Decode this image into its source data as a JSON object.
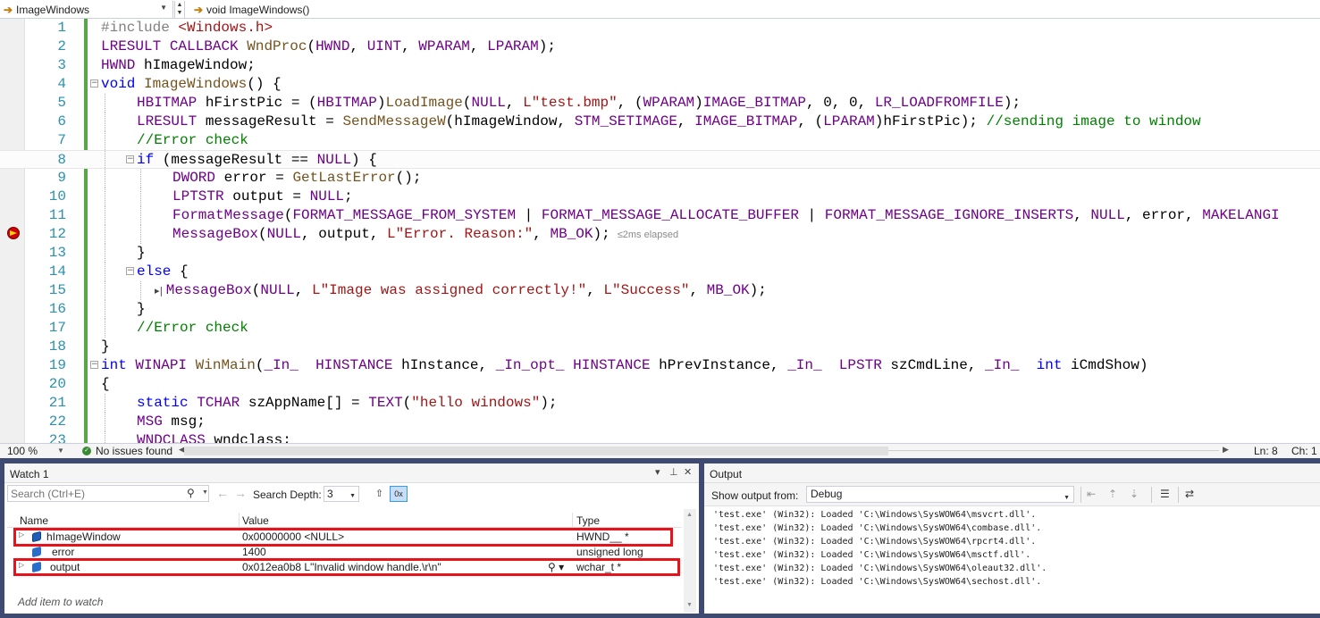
{
  "navbar": {
    "scope": "ImageWindows",
    "member": "void ImageWindows()"
  },
  "editor": {
    "lines": [
      {
        "n": "1",
        "parts": [
          [
            "pp",
            "#include "
          ],
          [
            "str",
            "<Windows.h>"
          ]
        ]
      },
      {
        "n": "2",
        "parts": [
          [
            "mac",
            "LRESULT"
          ],
          [
            "",
            " "
          ],
          [
            "mac",
            "CALLBACK"
          ],
          [
            "",
            " "
          ],
          [
            "fn",
            "WndProc"
          ],
          [
            "",
            "("
          ],
          [
            "mac",
            "HWND"
          ],
          [
            "",
            ", "
          ],
          [
            "mac",
            "UINT"
          ],
          [
            "",
            ", "
          ],
          [
            "mac",
            "WPARAM"
          ],
          [
            "",
            ", "
          ],
          [
            "mac",
            "LPARAM"
          ],
          [
            "",
            ");"
          ]
        ]
      },
      {
        "n": "3",
        "parts": [
          [
            "mac",
            "HWND"
          ],
          [
            "",
            " hImageWindow;"
          ]
        ]
      },
      {
        "n": "4",
        "fold": "−",
        "parts": [
          [
            "k",
            "void"
          ],
          [
            "",
            " "
          ],
          [
            "fn",
            "ImageWindows"
          ],
          [
            "",
            "() {"
          ]
        ]
      },
      {
        "n": "5",
        "indent": 1,
        "parts": [
          [
            "mac",
            "HBITMAP"
          ],
          [
            "",
            " hFirstPic = ("
          ],
          [
            "mac",
            "HBITMAP"
          ],
          [
            "",
            ")"
          ],
          [
            "fn",
            "LoadImage"
          ],
          [
            "",
            "("
          ],
          [
            "mac",
            "NULL"
          ],
          [
            "",
            ", "
          ],
          [
            "str",
            "L\"test.bmp\""
          ],
          [
            "",
            ", ("
          ],
          [
            "mac",
            "WPARAM"
          ],
          [
            "",
            ")"
          ],
          [
            "mac",
            "IMAGE_BITMAP"
          ],
          [
            "",
            ", "
          ],
          [
            "num",
            "0"
          ],
          [
            "",
            ", "
          ],
          [
            "num",
            "0"
          ],
          [
            "",
            ", "
          ],
          [
            "mac",
            "LR_LOADFROMFILE"
          ],
          [
            "",
            ");"
          ]
        ]
      },
      {
        "n": "6",
        "indent": 1,
        "parts": [
          [
            "mac",
            "LRESULT"
          ],
          [
            "",
            " messageResult = "
          ],
          [
            "fn",
            "SendMessageW"
          ],
          [
            "",
            "(hImageWindow, "
          ],
          [
            "mac",
            "STM_SETIMAGE"
          ],
          [
            "",
            ", "
          ],
          [
            "mac",
            "IMAGE_BITMAP"
          ],
          [
            "",
            ", ("
          ],
          [
            "mac",
            "LPARAM"
          ],
          [
            "",
            ")hFirstPic); "
          ],
          [
            "cm",
            "//sending image to window"
          ]
        ]
      },
      {
        "n": "7",
        "indent": 1,
        "parts": [
          [
            "cm",
            "//Error check"
          ]
        ]
      },
      {
        "n": "8",
        "indent": 1,
        "fold": "−",
        "current": true,
        "parts": [
          [
            "k",
            "if"
          ],
          [
            "",
            " (messageResult == "
          ],
          [
            "mac",
            "NULL"
          ],
          [
            "",
            ") {"
          ]
        ]
      },
      {
        "n": "9",
        "indent": 2,
        "parts": [
          [
            "mac",
            "DWORD"
          ],
          [
            "",
            " error = "
          ],
          [
            "fn",
            "GetLastError"
          ],
          [
            "",
            "();"
          ]
        ]
      },
      {
        "n": "10",
        "indent": 2,
        "parts": [
          [
            "mac",
            "LPTSTR"
          ],
          [
            "",
            " output = "
          ],
          [
            "mac",
            "NULL"
          ],
          [
            "",
            ";"
          ]
        ]
      },
      {
        "n": "11",
        "indent": 2,
        "parts": [
          [
            "mac",
            "FormatMessage"
          ],
          [
            "",
            "("
          ],
          [
            "mac",
            "FORMAT_MESSAGE_FROM_SYSTEM"
          ],
          [
            "",
            " | "
          ],
          [
            "mac",
            "FORMAT_MESSAGE_ALLOCATE_BUFFER"
          ],
          [
            "",
            " | "
          ],
          [
            "mac",
            "FORMAT_MESSAGE_IGNORE_INSERTS"
          ],
          [
            "",
            ", "
          ],
          [
            "mac",
            "NULL"
          ],
          [
            "",
            ", error, "
          ],
          [
            "mac",
            "MAKELANGI"
          ]
        ]
      },
      {
        "n": "12",
        "indent": 2,
        "elapsed": "≤2ms elapsed",
        "parts": [
          [
            "mac",
            "MessageBox"
          ],
          [
            "",
            "("
          ],
          [
            "mac",
            "NULL"
          ],
          [
            "",
            ", output, "
          ],
          [
            "str",
            "L\"Error. Reason:\""
          ],
          [
            "",
            ", "
          ],
          [
            "mac",
            "MB_OK"
          ],
          [
            "",
            ");"
          ]
        ]
      },
      {
        "n": "13",
        "indent": 1,
        "parts": [
          [
            "",
            "}"
          ]
        ]
      },
      {
        "n": "14",
        "indent": 1,
        "fold": "−",
        "parts": [
          [
            "k",
            "else"
          ],
          [
            "",
            " {"
          ]
        ]
      },
      {
        "n": "15",
        "indent": 2,
        "step": true,
        "parts": [
          [
            "mac",
            "MessageBox"
          ],
          [
            "",
            "("
          ],
          [
            "mac",
            "NULL"
          ],
          [
            "",
            ", "
          ],
          [
            "str",
            "L\"Image was assigned correctly!\""
          ],
          [
            "",
            ", "
          ],
          [
            "str",
            "L\"Success\""
          ],
          [
            "",
            ", "
          ],
          [
            "mac",
            "MB_OK"
          ],
          [
            "",
            ");"
          ]
        ]
      },
      {
        "n": "16",
        "indent": 1,
        "parts": [
          [
            "",
            "}"
          ]
        ]
      },
      {
        "n": "17",
        "indent": 1,
        "parts": [
          [
            "cm",
            "//Error check"
          ]
        ]
      },
      {
        "n": "18",
        "parts": [
          [
            "",
            "}"
          ]
        ]
      },
      {
        "n": "19",
        "fold": "−",
        "parts": [
          [
            "k",
            "int"
          ],
          [
            "",
            " "
          ],
          [
            "mac",
            "WINAPI"
          ],
          [
            "",
            " "
          ],
          [
            "fn",
            "WinMain"
          ],
          [
            "",
            "("
          ],
          [
            "mac",
            "_In_"
          ],
          [
            "",
            "  "
          ],
          [
            "mac",
            "HINSTANCE"
          ],
          [
            "",
            " hInstance, "
          ],
          [
            "mac",
            "_In_opt_"
          ],
          [
            "",
            " "
          ],
          [
            "mac",
            "HINSTANCE"
          ],
          [
            "",
            " hPrevInstance, "
          ],
          [
            "mac",
            "_In_"
          ],
          [
            "",
            "  "
          ],
          [
            "mac",
            "LPSTR"
          ],
          [
            "",
            " szCmdLine, "
          ],
          [
            "mac",
            "_In_"
          ],
          [
            "",
            "  "
          ],
          [
            "k",
            "int"
          ],
          [
            "",
            " iCmdShow)"
          ]
        ]
      },
      {
        "n": "20",
        "parts": [
          [
            "",
            "{"
          ]
        ]
      },
      {
        "n": "21",
        "indent": 1,
        "parts": [
          [
            "k",
            "static"
          ],
          [
            "",
            " "
          ],
          [
            "mac",
            "TCHAR"
          ],
          [
            "",
            " szAppName[] = "
          ],
          [
            "mac",
            "TEXT"
          ],
          [
            "",
            "("
          ],
          [
            "str",
            "\"hello windows\""
          ],
          [
            "",
            ");"
          ]
        ]
      },
      {
        "n": "22",
        "indent": 1,
        "parts": [
          [
            "mac",
            "MSG"
          ],
          [
            "",
            " msg;"
          ]
        ]
      },
      {
        "n": "23",
        "indent": 1,
        "parts": [
          [
            "mac",
            "WNDCLASS"
          ],
          [
            "",
            " wndclass;"
          ]
        ]
      }
    ]
  },
  "status_bar": {
    "zoom": "100 %",
    "issues": "No issues found",
    "line": "Ln: 8",
    "column": "Ch: 1"
  },
  "watch": {
    "title": "Watch 1",
    "search_placeholder": "Search (Ctrl+E)",
    "search_depth_label": "Search Depth:",
    "search_depth_value": "3",
    "columns": [
      "Name",
      "Value",
      "Type"
    ],
    "rows": [
      {
        "name": "hImageWindow",
        "value": "0x00000000 <NULL>",
        "type": "HWND__ *",
        "expandable": true,
        "highlighted": true
      },
      {
        "name": "error",
        "value": "1400",
        "type": "unsigned long",
        "expandable": false,
        "highlighted": false
      },
      {
        "name": "output",
        "value": "0x012ea0b8 L\"Invalid window handle.\\r\\n\"",
        "type": "wchar_t *",
        "expandable": true,
        "highlighted": true
      }
    ],
    "add_item": "Add item to watch",
    "highlight_color": "#e8121b"
  },
  "output": {
    "title": "Output",
    "show_from_label": "Show output from:",
    "source": "Debug",
    "lines": [
      "'test.exe' (Win32): Loaded 'C:\\Windows\\SysWOW64\\msvcrt.dll'.",
      "'test.exe' (Win32): Loaded 'C:\\Windows\\SysWOW64\\combase.dll'.",
      "'test.exe' (Win32): Loaded 'C:\\Windows\\SysWOW64\\rpcrt4.dll'.",
      "'test.exe' (Win32): Loaded 'C:\\Windows\\SysWOW64\\msctf.dll'.",
      "'test.exe' (Win32): Loaded 'C:\\Windows\\SysWOW64\\oleaut32.dll'.",
      "'test.exe' (Win32): Loaded 'C:\\Windows\\SysWOW64\\sechost.dll'."
    ]
  },
  "colors": {
    "tool_window_frame": "#3f4a73",
    "change_bar": "#57a64a",
    "line_number": "#2b91af",
    "macro": "#6f008a",
    "keyword": "#0000ff",
    "string": "#a31515",
    "comment": "#008000"
  },
  "icons": {
    "nav": "arrow-right-icon",
    "breakpoint": "current-statement-breakpoint-icon",
    "issues": "check-circle-icon",
    "search": "search-icon",
    "variable": "variable-icon"
  }
}
